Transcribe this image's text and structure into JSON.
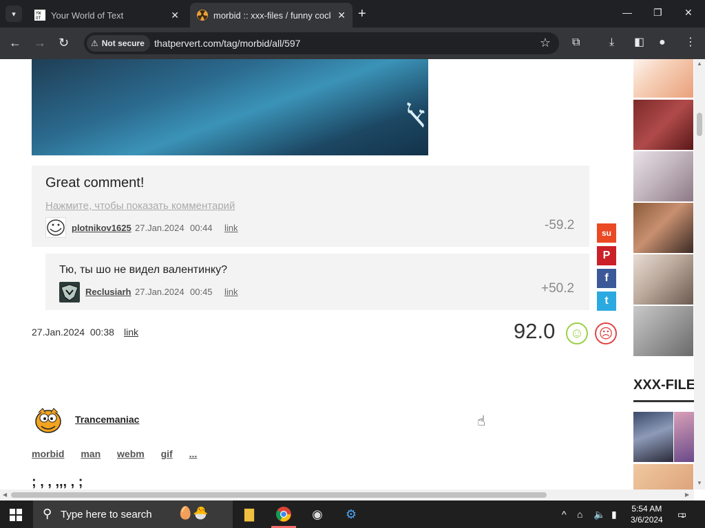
{
  "browser": {
    "tabs": [
      {
        "title": "Your World of Text",
        "active": false,
        "favicon": "yowot-icon"
      },
      {
        "title": "morbid :: xxx-files / funny cocks",
        "active": true,
        "favicon": "radioactive-icon"
      }
    ],
    "security_label": "Not secure",
    "url": "thatpervert.com/tag/morbid/all/597"
  },
  "comments": [
    {
      "text": "Great comment!",
      "hidden_link": "Нажмите, чтобы показать комментарий",
      "user": "plotnikov1625",
      "date": "27.Jan.2024",
      "time": "00:44",
      "link": "link",
      "score": "-59.2"
    },
    {
      "text": "Тю, ты шо не видел валентинку?",
      "user": "Reclusiarh",
      "date": "27.Jan.2024",
      "time": "00:45",
      "link": "link",
      "score": "+50.2"
    }
  ],
  "post": {
    "date": "27.Jan.2024",
    "time": "00:38",
    "link": "link",
    "rating": "92.0",
    "author": "Trancemaniac",
    "tags": [
      "morbid",
      "man",
      "webm",
      "gif",
      "..."
    ],
    "partial_text": "; , , ,,, , ;"
  },
  "share_buttons": [
    {
      "name": "stumbleupon-icon",
      "glyph": "su",
      "color": "#eb4924"
    },
    {
      "name": "pinterest-icon",
      "glyph": "P",
      "color": "#cb2027"
    },
    {
      "name": "facebook-icon",
      "glyph": "f",
      "color": "#3b5998"
    },
    {
      "name": "twitter-icon",
      "glyph": "t",
      "color": "#2ba9e1"
    }
  ],
  "sidebar": {
    "header": "XXX-FILES"
  },
  "taskbar": {
    "search_placeholder": "Type here to search",
    "time": "5:54 AM",
    "date": "3/6/2024",
    "notification_count": "1"
  }
}
